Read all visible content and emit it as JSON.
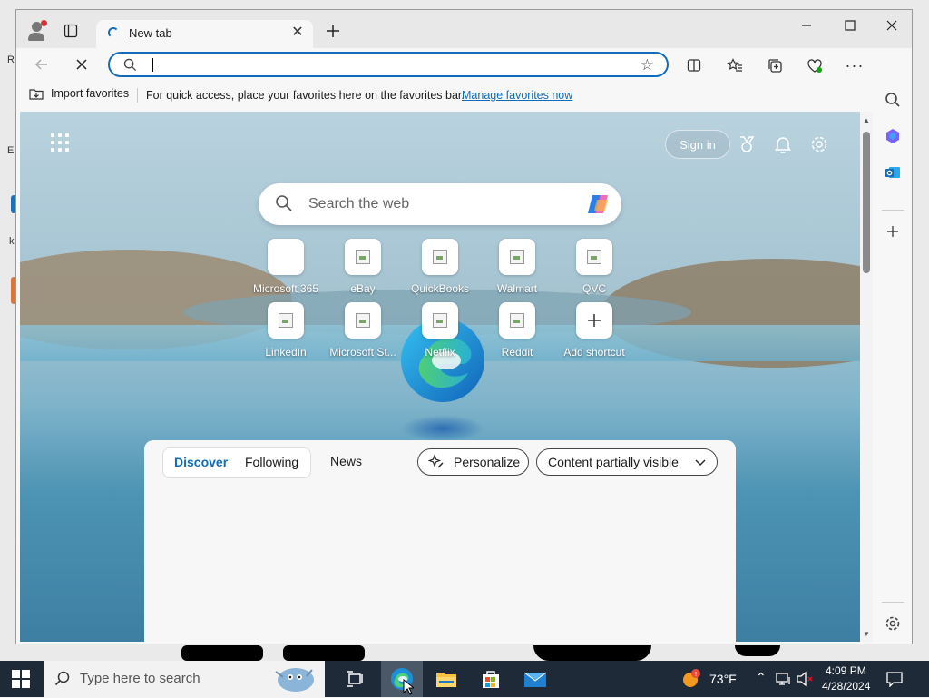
{
  "tab": {
    "title": "New tab"
  },
  "address": {
    "value": "",
    "placeholder": ""
  },
  "favorites_bar": {
    "import_label": "Import favorites",
    "message": "For quick access, place your favorites here on the favorites bar.",
    "manage_link": "Manage favorites now"
  },
  "newtab": {
    "signin_label": "Sign in",
    "search_placeholder": "Search the web",
    "shortcuts": [
      {
        "label": "Microsoft 365"
      },
      {
        "label": "eBay"
      },
      {
        "label": "QuickBooks"
      },
      {
        "label": "Walmart"
      },
      {
        "label": "QVC"
      },
      {
        "label": "LinkedIn"
      },
      {
        "label": "Microsoft St..."
      },
      {
        "label": "Netflix"
      },
      {
        "label": "Reddit"
      },
      {
        "label": "Add shortcut"
      }
    ],
    "feed": {
      "tabs": [
        "Discover",
        "Following"
      ],
      "active_tab": "Discover",
      "news_label": "News",
      "personalize_label": "Personalize",
      "content_label": "Content partially visible"
    }
  },
  "taskbar": {
    "search_placeholder": "Type here to search",
    "weather": "73°F",
    "time": "4:09 PM",
    "date": "4/28/2024"
  },
  "colors": {
    "accent": "#0f6cbd",
    "taskbar": "#1f2a38"
  }
}
